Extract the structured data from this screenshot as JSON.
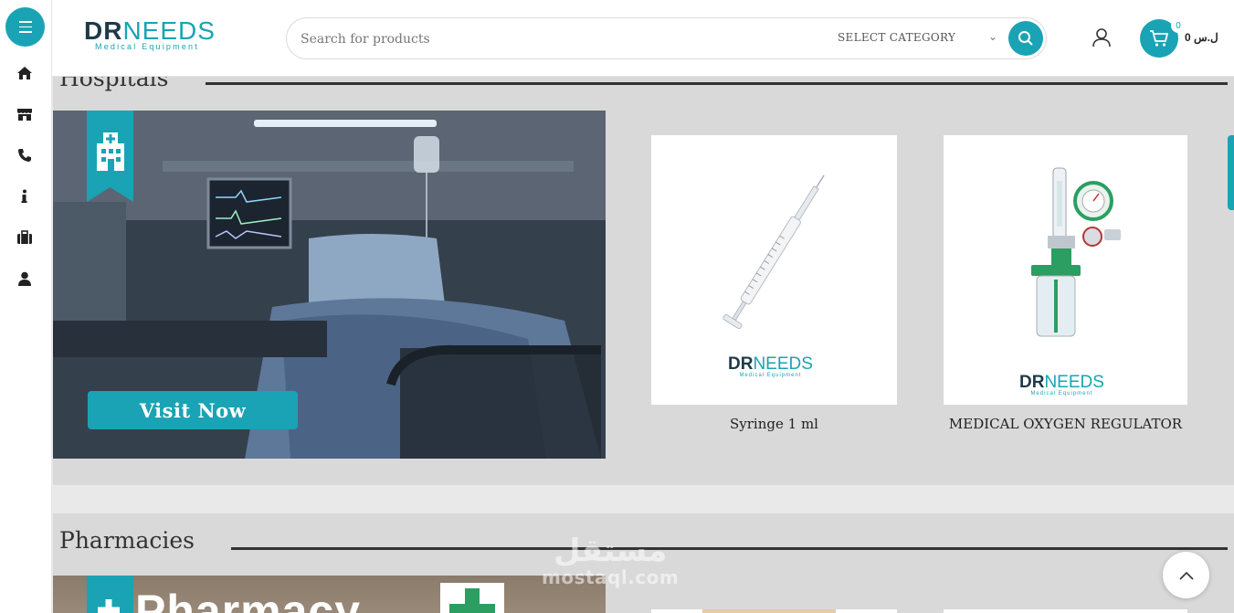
{
  "brand": {
    "logo_main": "DR",
    "logo_rest": "NEEDS",
    "logo_sub": "Medical Equipment"
  },
  "header": {
    "search_placeholder": "Search for products",
    "category_label": "SELECT CATEGORY",
    "cart_count": "0",
    "cart_total": "0 ل.س"
  },
  "sidebar": {
    "items": [
      {
        "icon": "home-icon"
      },
      {
        "icon": "store-icon"
      },
      {
        "icon": "phone-icon"
      },
      {
        "icon": "info-icon"
      },
      {
        "icon": "briefcase-icon"
      },
      {
        "icon": "user-icon"
      }
    ]
  },
  "sections": [
    {
      "title": "Hospitals",
      "banner_button": "Visit Now",
      "banner_icon": "hospital-icon",
      "products": [
        {
          "name": "Syringe 1 ml",
          "logo_main": "DR",
          "logo_rest": "NEEDS",
          "logo_sub": "Medical Equipment"
        },
        {
          "name": "MEDICAL OXYGEN REGULATOR",
          "logo_main": "DR",
          "logo_rest": "NEEDS",
          "logo_sub": "Medical Equipment"
        }
      ]
    },
    {
      "title": "Pharmacies",
      "banner_text": "Pharmacy",
      "banner_icon": "pharmacy-cross-icon"
    }
  ],
  "watermark": {
    "arabic": "مستقل",
    "latin": "mostaql.com"
  },
  "colors": {
    "accent": "#1aa3b4",
    "dark": "#1e3a48",
    "section_bg": "#d9d9d9"
  }
}
